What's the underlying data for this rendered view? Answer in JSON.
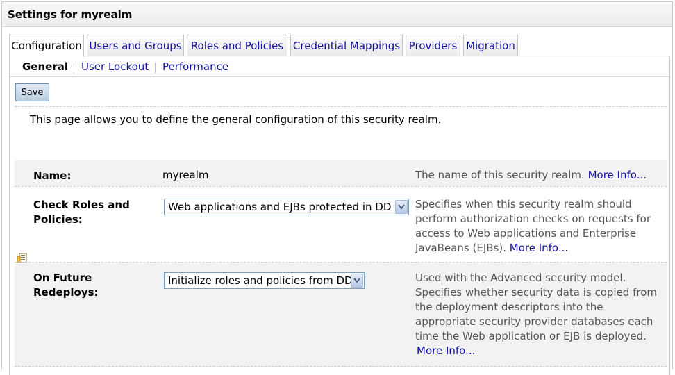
{
  "window": {
    "title": "Settings for myrealm"
  },
  "tabs": [
    {
      "label": "Configuration",
      "active": true
    },
    {
      "label": "Users and Groups"
    },
    {
      "label": "Roles and Policies"
    },
    {
      "label": "Credential Mappings"
    },
    {
      "label": "Providers"
    },
    {
      "label": "Migration"
    }
  ],
  "subtabs": [
    {
      "label": "General",
      "active": true
    },
    {
      "label": "User Lockout"
    },
    {
      "label": "Performance"
    }
  ],
  "toolbar": {
    "save_label": "Save"
  },
  "intro": "This page allows you to define the general configuration of this security realm.",
  "fields": {
    "name": {
      "label": "Name:",
      "value": "myrealm",
      "help": "The name of this security realm.",
      "more": "More Info..."
    },
    "check_roles": {
      "label_line1": "Check Roles and",
      "label_line2": "Policies:",
      "value": "Web applications and EJBs protected in DD",
      "help": "Specifies when this security realm should perform authorization checks on requests for access to Web applications and Enterprise JavaBeans (EJBs).",
      "more": "More Info..."
    },
    "future_redeploys": {
      "label_line1": "On Future",
      "label_line2": "Redeploys:",
      "value": "Initialize roles and policies from DD",
      "help": "Used with the Advanced security model. Specifies whether security data is copied from the deployment descriptors into the appropriate security provider databases each time the Web application or EJB is deployed.",
      "more": "More Info..."
    }
  },
  "icons": {
    "dynamic_change": "flag-page-icon",
    "dropdown": "chevron-down-icon"
  }
}
